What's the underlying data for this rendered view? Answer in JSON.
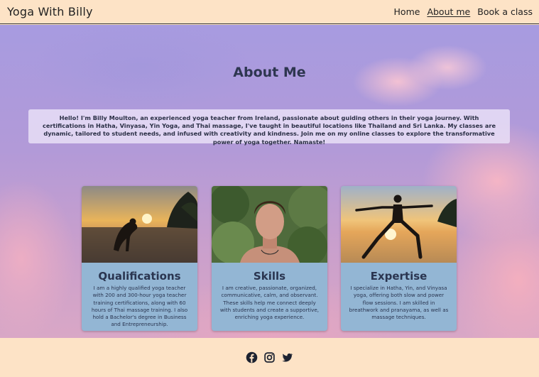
{
  "nav": {
    "brand": "Yoga With Billy",
    "links": [
      {
        "label": "Home"
      },
      {
        "label": "About me",
        "active": true
      },
      {
        "label": "Book a class"
      }
    ]
  },
  "hero": {
    "title": "About Me",
    "intro": "Hello! I'm Billy Moulton, an experienced yoga teacher from Ireland, passionate about guiding others in their yoga journey. With certifications in Hatha, Vinyasa, Yin Yoga, and Thai massage, I've taught in beautiful locations like Thailand and Sri Lanka. My classes are dynamic, tailored to student needs, and infused with creativity and kindness. Join me on my online classes to explore the transformative power of yoga together. Namaste!"
  },
  "cards": [
    {
      "title": "Qualifications",
      "text": "I am a highly qualified yoga teacher with 200 and 300-hour yoga teacher training certifications, along with 60 hours of Thai massage training. I also hold a Bachelor's degree in Business and Entrepreneurship."
    },
    {
      "title": "Skills",
      "text": "I am creative, passionate, organized, communicative, calm, and observant. These skills help me connect deeply with students and create a supportive, enriching yoga experience."
    },
    {
      "title": "Expertise",
      "text": "I specialize in Hatha, Yin, and Vinyasa yoga, offering both slow and power flow sessions. I am skilled in breathwork and pranayama, as well as massage techniques."
    }
  ],
  "footer": {
    "icons": [
      "facebook-icon",
      "instagram-icon",
      "twitter-icon"
    ]
  },
  "colors": {
    "nav_bg": "#fde3c6",
    "card_bg": "#93b6d4",
    "heading": "#2e3650"
  }
}
